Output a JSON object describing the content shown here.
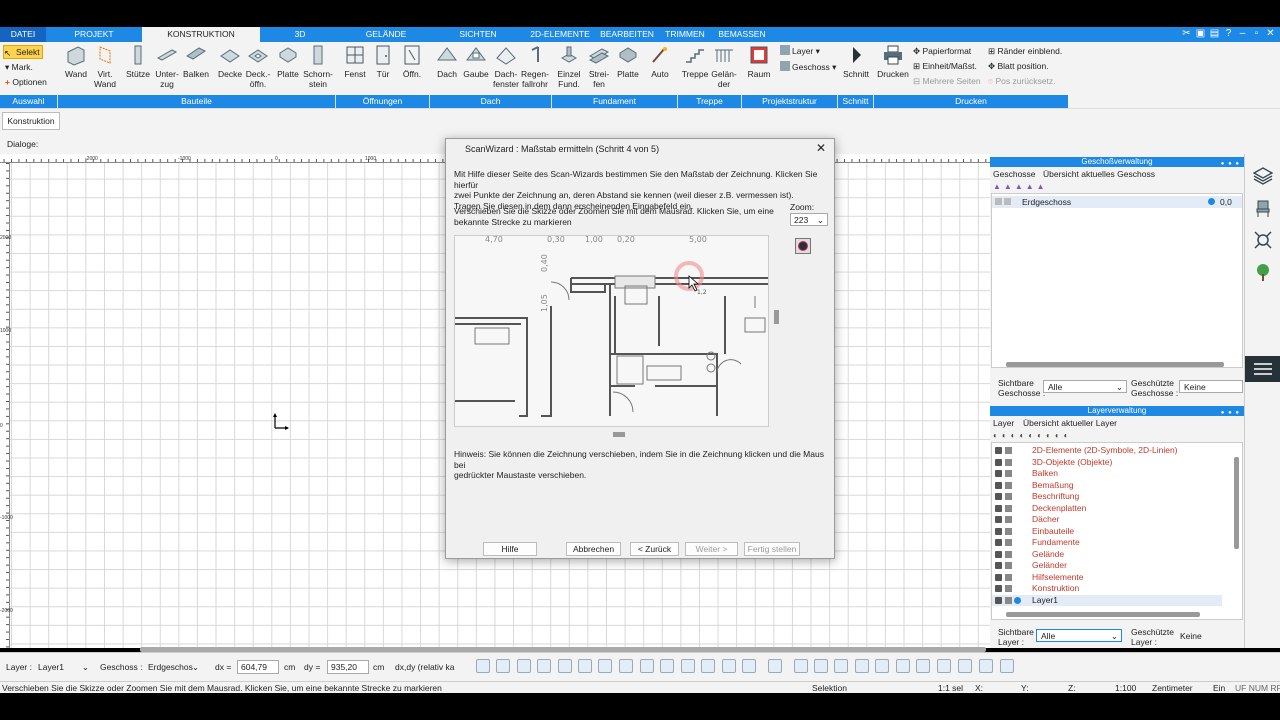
{
  "tabs": [
    "DATEI",
    "PROJEKT",
    "KONSTRUKTION",
    "3D",
    "GELÄNDE",
    "SICHTEN",
    "2D-ELEMENTE",
    "BEARBEITEN",
    "TRIMMEN",
    "BEMASSEN"
  ],
  "colors": {
    "accent": "#1e88e5",
    "layer_text": "#c0392b",
    "panel_bg": "#f3f3f3"
  },
  "ribbon": {
    "auswahl": {
      "selekt": "Selekt",
      "mark": "Mark.",
      "optionen": "Optionen"
    },
    "bauteile": [
      "Wand",
      "Virt.",
      "Wand",
      "Stütze",
      "Unter-",
      "zug",
      "Balken",
      "Decke",
      "Deck.-",
      "öffn.",
      "Platte",
      "Schorn-",
      "stein"
    ],
    "oeffnungen": [
      "Fenst",
      "Tür",
      "Öffn."
    ],
    "dach": [
      "Dach",
      "Gaube",
      "Dach-",
      "fenster",
      "Regen-",
      "fallrohr"
    ],
    "fundament": [
      "Einzel",
      "Fund.",
      "Strei-",
      "fen",
      "Platte",
      "Auto"
    ],
    "treppe": [
      "Treppe",
      "Gelän-",
      "der"
    ],
    "raumstruktur": {
      "raum": "Raum",
      "layer": "Layer",
      "geschoss": "Geschoss"
    },
    "schnitt": "Schnitt",
    "drucken": {
      "drucken": "Drucken",
      "papierformat": "Papierformat",
      "einheit": "Einheit/Maßst.",
      "mehrere": "Mehrere Seiten",
      "raender": "Ränder einblend.",
      "blatt": "Blatt position.",
      "pos": "Pos zurücksetz."
    },
    "groups": [
      "Auswahl",
      "Bauteile",
      "Öffnungen",
      "Dach",
      "Fundament",
      "Treppe",
      "Projektstruktur",
      "Schnitt",
      "Drucken"
    ]
  },
  "row2": {
    "tab": "Konstruktion",
    "dialoge": "Dialoge:"
  },
  "ruler": {
    "top": [
      "-2000",
      "-1000",
      "0",
      "1000",
      "2000"
    ],
    "left": [
      "2000",
      "1000",
      "0",
      "-1000",
      "-2000"
    ]
  },
  "dialog": {
    "title": "ScanWizard : Maßstab ermitteln (Schritt 4 von 5)",
    "text1_l1": "Mit Hilfe dieser Seite des Scan-Wizards bestimmen Sie den Maßstab der Zeichnung. Klicken Sie  hierfür",
    "text1_l2": "zwei Punkte der Zeichnung an, deren Abstand sie kennen (weil dieser z.B. vermessen ist).",
    "text1_l3": "Tragen Sie diesen in dem dann erscheinenden Eingabefeld ein.",
    "text2_l1": "Verschieben Sie die Skizze oder Zoomen Sie mit dem Mausrad. Klicken Sie, um eine",
    "text2_l2": "bekannte Strecke zu markieren",
    "zoom_label": "Zoom:",
    "zoom_value": "223",
    "preview_labels": [
      "4,70",
      "0,30",
      "1,00",
      "0,20",
      "5,00",
      "0,40",
      "1,05",
      "1,2"
    ],
    "hint_l1": "Hinweis: Sie können die Zeichnung verschieben, indem Sie in die Zeichnung klicken und die Maus bei",
    "hint_l2": "gedrückter Maustaste verschieben.",
    "buttons": {
      "hilfe": "Hilfe",
      "abbrechen": "Abbrechen",
      "zurueck": "< Zurück",
      "weiter": "Weiter >",
      "fertig": "Fertig stellen"
    }
  },
  "geschoss": {
    "header": "Geschoßverwaltung",
    "tab1": "Geschosse",
    "tab2": "Übersicht aktuelles Geschoss",
    "row": "Erdgeschoss",
    "row_value": "0,0",
    "sichtbare_l1": "Sichtbare",
    "sichtbare_l2": "Geschosse :",
    "sichtbare_value": "Alle",
    "geschuetzte_l1": "Geschützte",
    "geschuetzte_l2": "Geschosse :",
    "geschuetzte_value": "Keine"
  },
  "layer": {
    "header": "Layerverwaltung",
    "tab1": "Layer",
    "tab2": "Übersicht aktueller Layer",
    "items": [
      "2D-Elemente (2D-Symbole, 2D-Linien)",
      "3D-Objekte (Objekte)",
      "Balken",
      "Bemaßung",
      "Beschriftung",
      "Deckenplatten",
      "Dächer",
      "Einbauteile",
      "Fundamente",
      "Gelände",
      "Geländer",
      "Hilfselemente",
      "Konstruktion",
      "Layer1"
    ],
    "sichtbare_l1": "Sichtbare",
    "sichtbare_l2": "Layer :",
    "sichtbare_value": "Alle",
    "geschuetzte_l1": "Geschützte",
    "geschuetzte_l2": "Layer :",
    "geschuetzte_value": "Keine"
  },
  "bottom": {
    "layer_label": "Layer :",
    "layer_value": "Layer1",
    "geschoss_label": "Geschoss :",
    "geschoss_value": "Erdgeschos",
    "dx_label": "dx =",
    "dx_value": "604,79",
    "dy_label": "dy =",
    "dy_value": "935,20",
    "unit": "cm",
    "mode_value": "dx,dy (relativ ka"
  },
  "status": {
    "message": "Verschieben Sie die Skizze oder Zoomen Sie mit dem Mausrad. Klicken Sie, um eine bekannte Strecke zu markieren",
    "mode": "Selektion",
    "sel": "1:1 sel",
    "x": "X:",
    "y": "Y:",
    "z": "Z:",
    "scale": "1:100",
    "unit": "Zentimeter",
    "ein": "Ein",
    "flags": "UF NUM RF"
  }
}
